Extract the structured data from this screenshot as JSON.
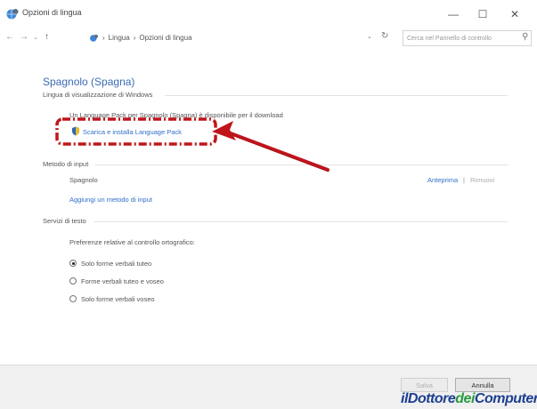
{
  "window": {
    "title": "Opzioni di lingua",
    "minimize_glyph": "—",
    "maximize_glyph": "☐",
    "close_glyph": "✕",
    "icon": "globe-settings-icon"
  },
  "navbar": {
    "breadcrumb": [
      "Lingua",
      "Opzioni di lingua"
    ],
    "separator": "›",
    "search_placeholder": "Cerca nel Pannello di controllo"
  },
  "main": {
    "heading": "Spagnolo (Spagna)",
    "display_section": {
      "label": "Lingua di visualizzazione di Windows",
      "message": "Un Language Pack per Spagnolo (Spagna) è disponibile per il download",
      "download_link": "Scarica e installa Language Pack"
    },
    "input_section": {
      "label": "Metodo di input",
      "method_name": "Spagnolo",
      "preview_link": "Anteprima",
      "divider": "|",
      "remove_link": "Rimuovi",
      "add_link": "Aggiungi un metodo di input"
    },
    "text_services": {
      "label": "Servizi di testo",
      "pref_title": "Preferenze relative al controllo ortografico:",
      "options": [
        {
          "label": "Solo forme verbali tuteo",
          "checked": true
        },
        {
          "label": "Forme verbali tuteo e voseo",
          "checked": false
        },
        {
          "label": "Solo forme verbali voseo",
          "checked": false
        }
      ]
    }
  },
  "footer": {
    "save_label": "Salva",
    "cancel_label": "Annulla"
  },
  "watermark": {
    "part1": "ilDottore",
    "part2": "dei",
    "part3": "Computer"
  },
  "colors": {
    "annotation": "#c0151b",
    "link": "#2f6fc8",
    "heading": "#3b6bb5"
  }
}
